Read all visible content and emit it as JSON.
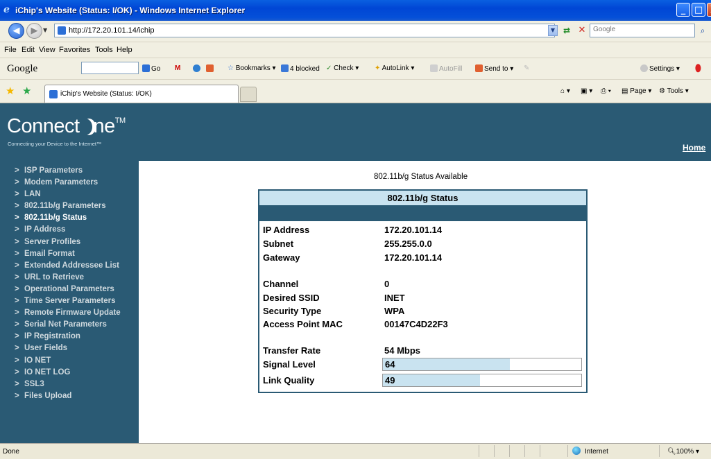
{
  "window": {
    "title": "iChip's Website (Status: I/OK) - Windows Internet Explorer",
    "min": "_",
    "max": "□",
    "close": "X"
  },
  "address": {
    "url": "http://172.20.101.14/ichip",
    "search_placeholder": "Google"
  },
  "menu": [
    "File",
    "Edit",
    "View",
    "Favorites",
    "Tools",
    "Help"
  ],
  "google_toolbar": {
    "logo": "Google",
    "go": "Go",
    "bookmarks": "Bookmarks",
    "blocked": "4 blocked",
    "check": "Check",
    "autolink": "AutoLink",
    "autofill": "AutoFill",
    "sendto": "Send to",
    "settings": "Settings"
  },
  "tabs": {
    "active_title": "iChip's Website (Status: I/OK)"
  },
  "commands": {
    "page": "Page",
    "tools": "Tools"
  },
  "site": {
    "logo_text_a": "Connect",
    "logo_text_b": "ne",
    "logo_tm": "TM",
    "tagline": "Connecting your Device to the Internet™",
    "home": "Home"
  },
  "sidebar": {
    "arrow": ">",
    "items": [
      "ISP Parameters",
      "Modem Parameters",
      "LAN",
      "802.11b/g Parameters",
      "802.11b/g Status",
      "IP Address",
      "Server Profiles",
      "Email Format",
      "Extended Addressee List",
      "URL to Retrieve",
      "Operational Parameters",
      "Time Server Parameters",
      "Remote Firmware Update",
      "Serial Net Parameters",
      "IP Registration",
      "User Fields",
      "IO NET",
      "IO NET LOG",
      "SSL3",
      "Files Upload"
    ],
    "active": "802.11b/g Status"
  },
  "status": {
    "available": "802.11b/g Status Available",
    "heading": "802.11b/g Status",
    "ip_label": "IP Address",
    "ip_value": "172.20.101.14",
    "subnet_label": "Subnet",
    "subnet_value": "255.255.0.0",
    "gateway_label": "Gateway",
    "gateway_value": "172.20.101.14",
    "channel_label": "Channel",
    "channel_value": "0",
    "ssid_label": "Desired SSID",
    "ssid_value": "INET",
    "security_label": "Security Type",
    "security_value": "WPA",
    "apmac_label": "Access Point MAC",
    "apmac_value": "00147C4D22F3",
    "rate_label": "Transfer Rate",
    "rate_value": "54 Mbps",
    "signal_label": "Signal Level",
    "signal_value": "64",
    "link_label": "Link Quality",
    "link_value": "49",
    "bar_fill_color": "#c9e3f0"
  },
  "statusbar": {
    "done": "Done",
    "zone": "Internet",
    "zoom": "100%"
  },
  "colors": {
    "brand": "#2a5a74",
    "highlight": "#c9e3f0"
  }
}
